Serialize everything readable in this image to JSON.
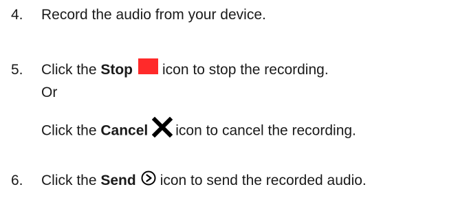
{
  "steps": [
    {
      "number": "4.",
      "text": "Record the audio from your device."
    },
    {
      "number": "5.",
      "prefix": "Click the ",
      "bold": "Stop",
      "icon": "stop-square-icon",
      "icon_color": "#ff2a2a",
      "suffix": "icon to stop the recording."
    },
    {
      "or_text": "Or"
    },
    {
      "prefix": "Click the ",
      "bold": "Cancel",
      "icon": "x-icon",
      "icon_color": "#000000",
      "suffix": "icon to cancel the recording."
    },
    {
      "number": "6.",
      "prefix": "Click the ",
      "bold": "Send",
      "icon": "play-circle-icon",
      "icon_color": "#000000",
      "suffix": "icon to send the recorded audio."
    }
  ]
}
